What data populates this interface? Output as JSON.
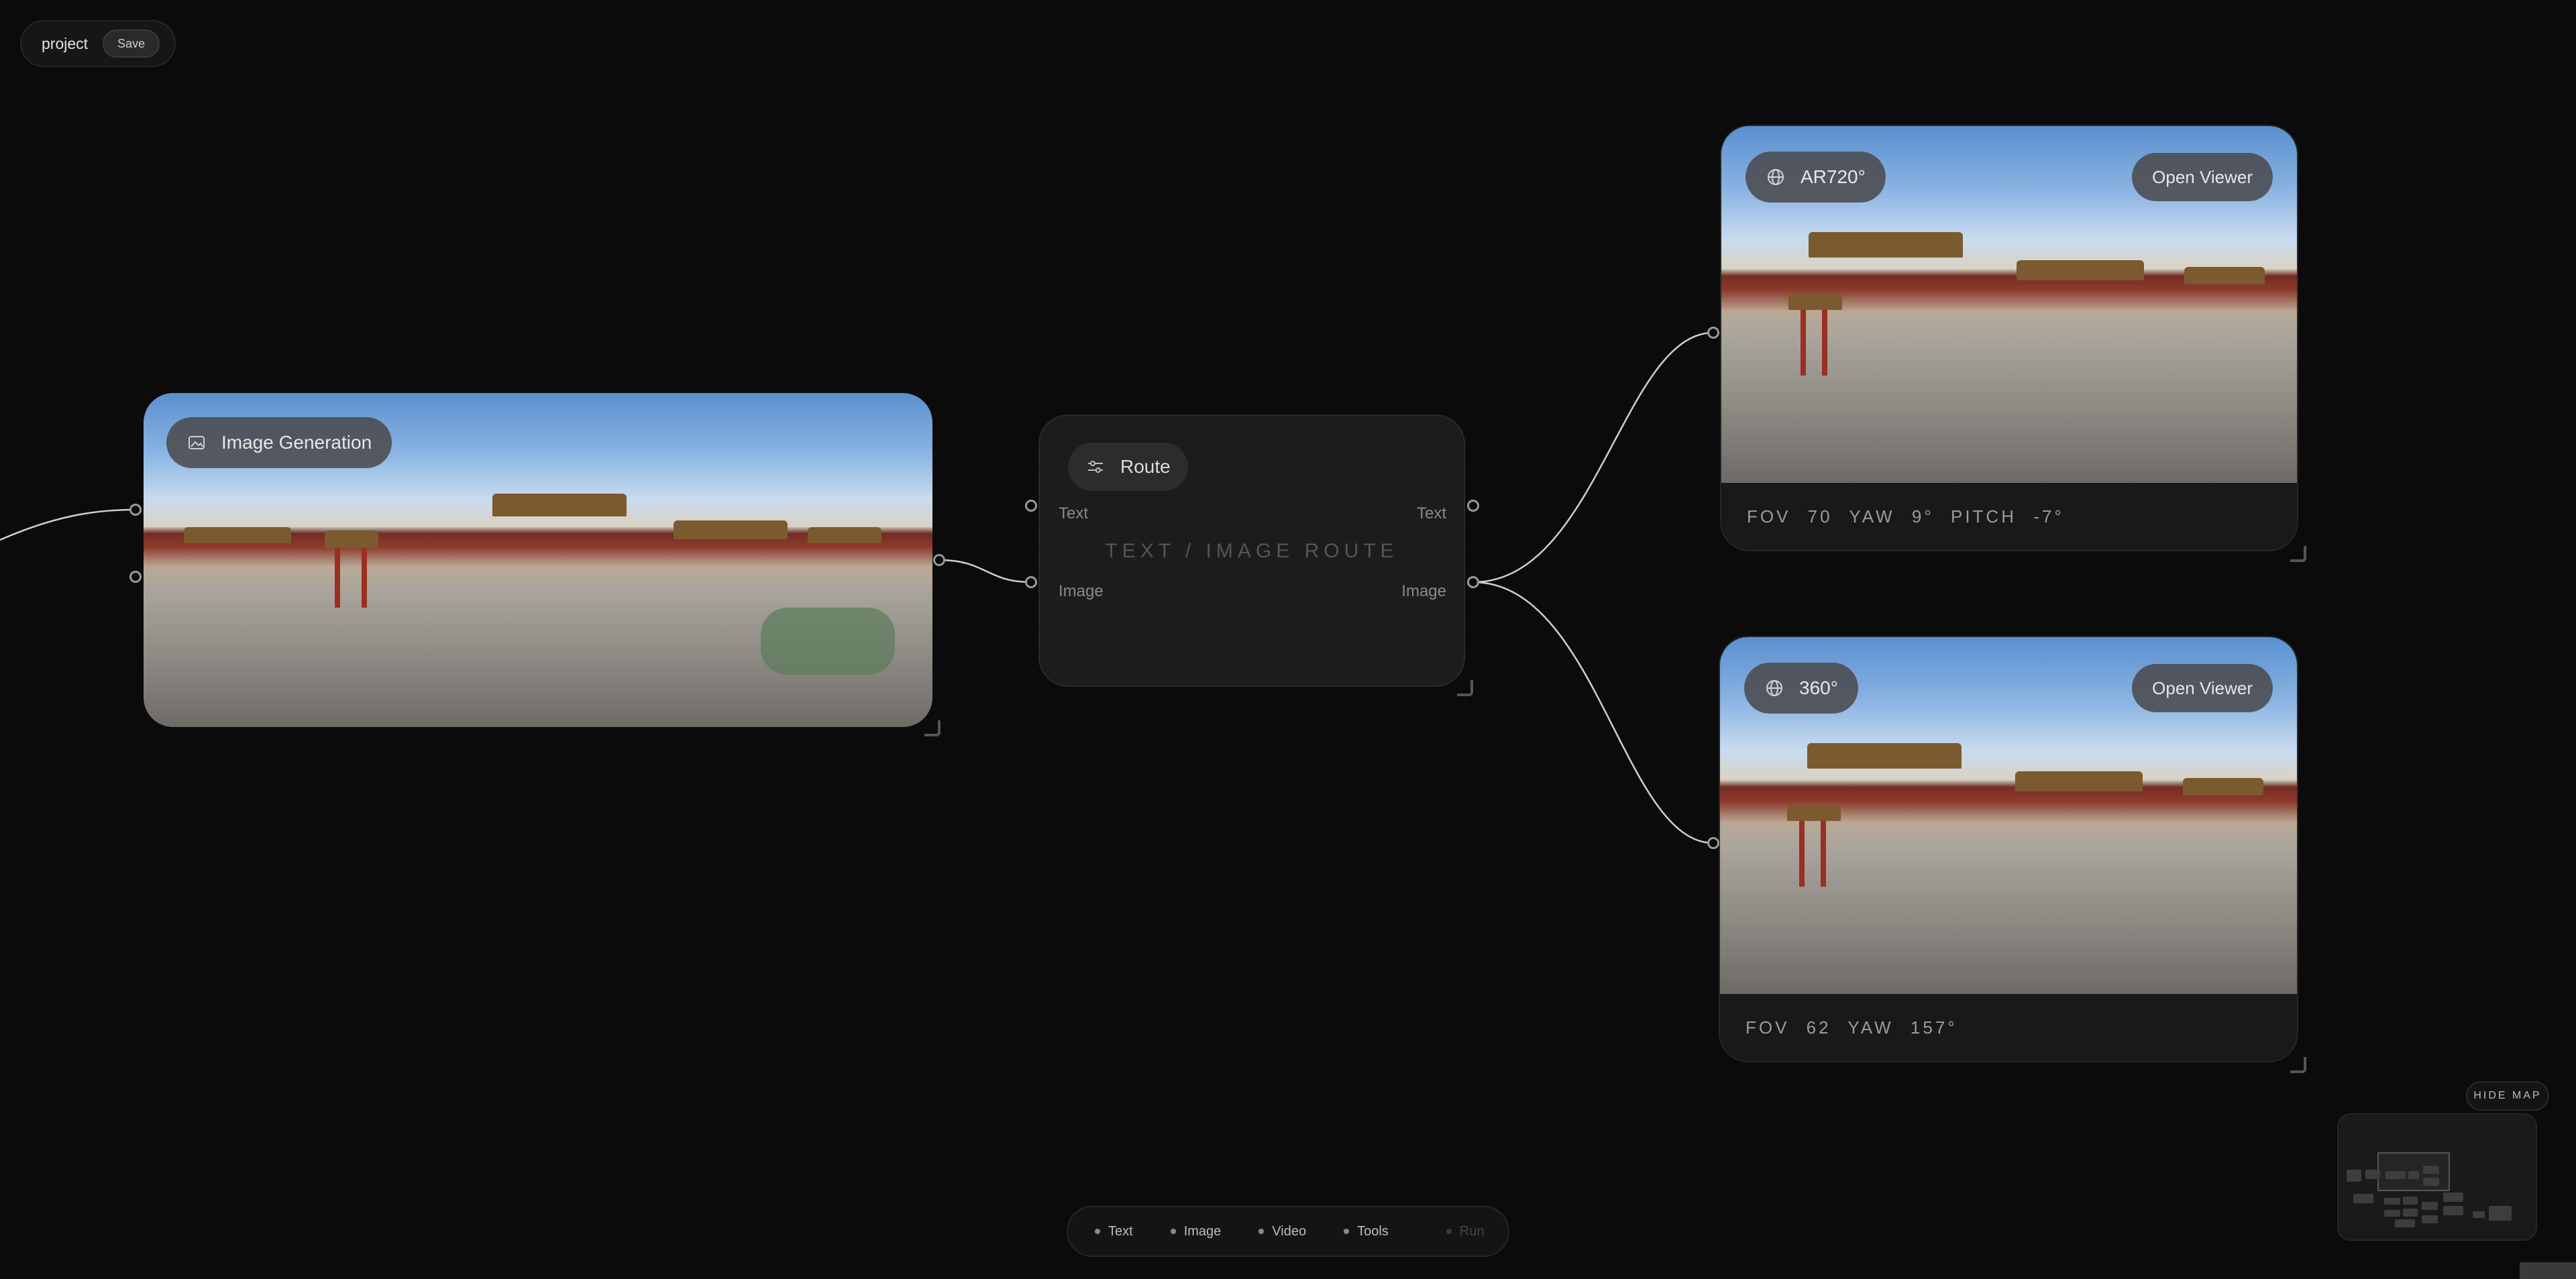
{
  "project": {
    "name": "project",
    "save_label": "Save"
  },
  "nodes": {
    "image_generation": {
      "title": "Image Generation"
    },
    "route": {
      "title": "Route",
      "caption": "TEXT / IMAGE ROUTE",
      "inputs": [
        "Text",
        "Image"
      ],
      "outputs": [
        "Text",
        "Image"
      ]
    },
    "viewer_top": {
      "title": "AR720°",
      "open_label": "Open Viewer",
      "readout": "FOV 70  YAW 9°  PITCH -7°"
    },
    "viewer_bottom": {
      "title": "360°",
      "open_label": "Open Viewer",
      "readout": "FOV 62  YAW 157°"
    }
  },
  "toolbar": {
    "items": [
      {
        "label": "Text",
        "icon": "dot-icon"
      },
      {
        "label": "Image",
        "icon": "dot-icon"
      },
      {
        "label": "Video",
        "icon": "dot-icon"
      },
      {
        "label": "Tools",
        "icon": "dot-icon"
      }
    ],
    "run_label": "Run"
  },
  "minimap": {
    "toggle_label": "HIDE MAP"
  },
  "colors": {
    "canvas": "#0b0b0b",
    "node_panel": "#1c1c1c",
    "pill": "#4b4b4e",
    "wire": "#d0d0d0"
  }
}
